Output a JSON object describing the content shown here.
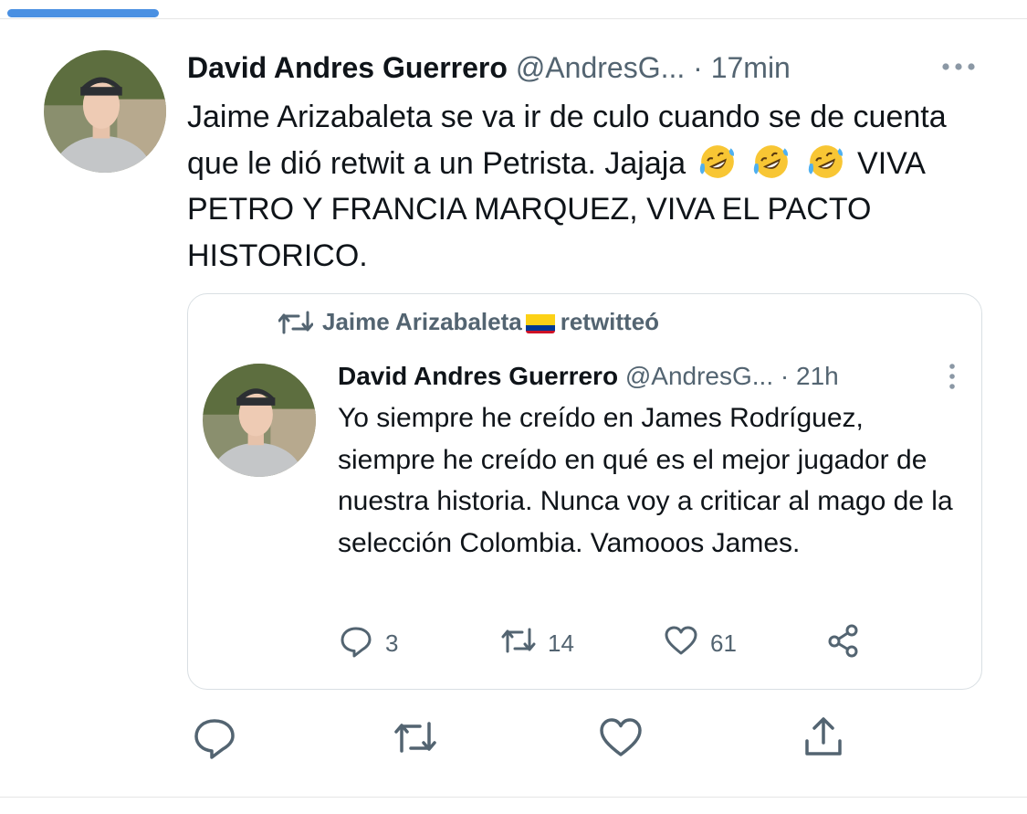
{
  "tweet": {
    "author_name": "David Andres Guerrero",
    "author_handle": "@AndresG...",
    "separator": "·",
    "time": "17min",
    "text_part1": "Jaime Arizabaleta se va ir de culo cuando se de cuenta que le dió retwit a un Petrista. Jajaja",
    "text_part2": "VIVA PETRO Y FRANCIA MARQUEZ, VIVA EL PACTO HISTORICO.",
    "emoji": "rolling-on-floor-laughing"
  },
  "quoted": {
    "retweeted_by": "Jaime Arizabaleta",
    "retweeted_label": "retwitteó",
    "author_name": "David Andres Guerrero",
    "author_handle": "@AndresG...",
    "separator": "·",
    "time": "21h",
    "text": "Yo siempre he creído en James Rodríguez, siempre he creído en qué es el mejor jugador de nuestra historia. Nunca voy a criticar al mago de la selección Colombia. Vamooos James.",
    "replies": "3",
    "retweets": "14",
    "likes": "61"
  },
  "icons": {
    "more": "more-horizontal-icon",
    "more_vertical": "more-vertical-icon",
    "retweet": "retweet-icon",
    "reply": "reply-icon",
    "like": "heart-icon",
    "share": "share-icon",
    "upload": "upload-icon",
    "flag": "colombia-flag-icon"
  },
  "colors": {
    "text": "#0f1419",
    "secondary": "#536471",
    "border": "#d9dfe3",
    "progress": "#4a90e2"
  }
}
